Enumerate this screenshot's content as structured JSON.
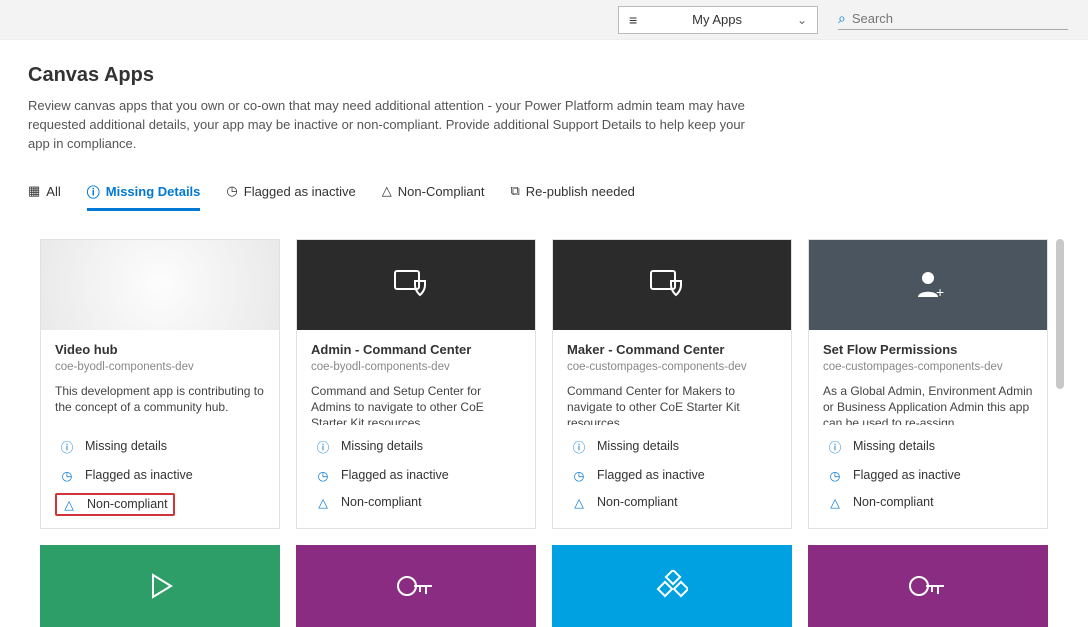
{
  "header": {
    "dropdown_label": "My Apps",
    "search_placeholder": "Search"
  },
  "page": {
    "title": "Canvas Apps",
    "description": "Review canvas apps that you own or co-own that may need additional attention - your Power Platform admin team may have requested additional details, your app may be inactive or non-compliant. Provide additional Support Details to help keep your app in compliance."
  },
  "tabs": [
    {
      "label": "All",
      "icon": "grid-icon"
    },
    {
      "label": "Missing Details",
      "icon": "info-icon",
      "active": true
    },
    {
      "label": "Flagged as inactive",
      "icon": "clock-icon"
    },
    {
      "label": "Non-Compliant",
      "icon": "warn-icon"
    },
    {
      "label": "Re-publish needed",
      "icon": "republish-icon"
    }
  ],
  "status_labels": {
    "missing": "Missing details",
    "inactive": "Flagged as inactive",
    "noncompliant": "Non-compliant"
  },
  "cards": [
    {
      "title": "Video hub",
      "env": "coe-byodl-components-dev",
      "desc": "This development app is contributing to the concept of a community hub.",
      "hero": "light",
      "highlight_noncompliant": true
    },
    {
      "title": "Admin - Command Center",
      "env": "coe-byodl-components-dev",
      "desc": "Command and Setup Center for Admins to navigate to other CoE Starter Kit resources",
      "hero": "dark-shield"
    },
    {
      "title": "Maker - Command Center",
      "env": "coe-custompages-components-dev",
      "desc": "Command Center for Makers to navigate to other CoE Starter Kit resources",
      "hero": "dark-shield"
    },
    {
      "title": "Set Flow Permissions",
      "env": "coe-custompages-components-dev",
      "desc": "As a Global Admin, Environment Admin or Business Application Admin this app can be used to re-assign ...",
      "hero": "slate-user"
    }
  ],
  "mini_tiles": [
    {
      "color": "green",
      "icon": "play-icon"
    },
    {
      "color": "purple",
      "icon": "key-icon"
    },
    {
      "color": "blue",
      "icon": "diamond-icon"
    },
    {
      "color": "purple",
      "icon": "key-icon"
    }
  ]
}
